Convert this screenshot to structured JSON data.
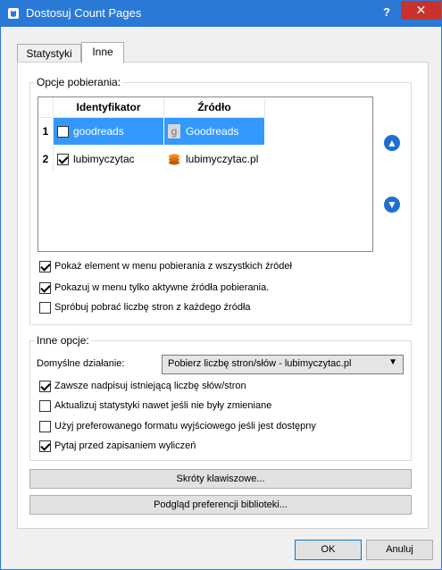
{
  "window": {
    "title": "Dostosuj Count Pages",
    "help": "?",
    "close": "✕"
  },
  "tabs": [
    {
      "label": "Statystyki"
    },
    {
      "label": "Inne"
    }
  ],
  "download_options": {
    "title": "Opcje pobierania:",
    "columns": {
      "id": "Identyfikator",
      "source": "Źródło"
    },
    "rows": [
      {
        "num": "1",
        "checked": false,
        "id": "goodreads",
        "source": "Goodreads",
        "source_icon": "goodreads-icon"
      },
      {
        "num": "2",
        "checked": true,
        "id": "lubimyczytac",
        "source": "lubimyczytac.pl",
        "source_icon": "lubimyczytac-icon"
      }
    ],
    "move_up": "move-up-icon",
    "move_down": "move-down-icon",
    "checks": [
      {
        "label": "Pokaż element w menu pobierania z wszystkich źródeł",
        "checked": true
      },
      {
        "label": "Pokazuj w menu tylko aktywne źródła pobierania.",
        "checked": true
      },
      {
        "label": "Spróbuj pobrać liczbę stron z każdego źródła",
        "checked": false
      }
    ]
  },
  "other_options": {
    "title": "Inne opcje:",
    "default_action_label": "Domyślne działanie:",
    "default_action_value": "Pobierz liczbę stron/słów - lubimyczytac.pl",
    "checks": [
      {
        "label": "Zawsze nadpisuj istniejącą liczbę słów/stron",
        "checked": true
      },
      {
        "label": "Aktualizuj statystyki nawet jeśli nie były zmieniane",
        "checked": false
      },
      {
        "label": "Użyj preferowanego formatu wyjściowego jeśli jest dostępny",
        "checked": false
      },
      {
        "label": "Pytaj przed zapisaniem wyliczeń",
        "checked": true
      }
    ]
  },
  "buttons": {
    "shortcuts": "Skróty klawiszowe...",
    "library_prefs": "Podgląd preferencji biblioteki...",
    "ok": "OK",
    "cancel": "Anuluj"
  },
  "colors": {
    "titlebar": "#2b79d7",
    "close": "#c7332c",
    "selection": "#3399ff",
    "arrow": "#1e6fd0"
  }
}
